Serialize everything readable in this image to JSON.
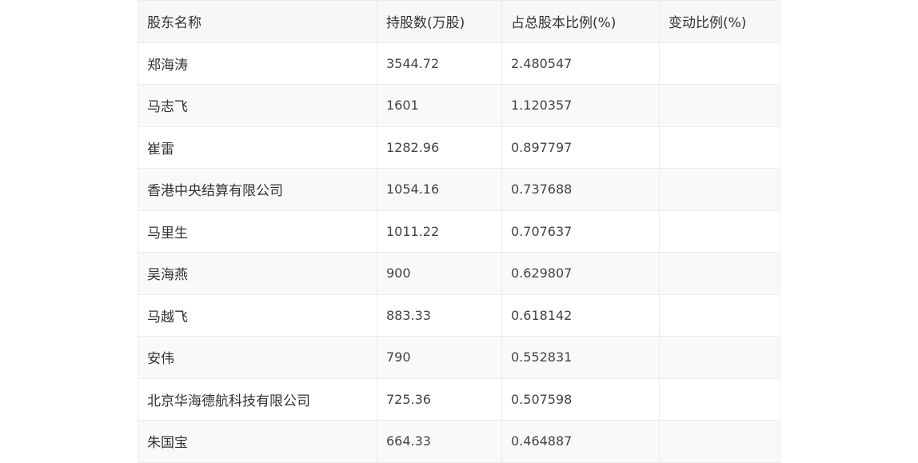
{
  "table": {
    "headers": [
      "股东名称",
      "持股数(万股)",
      "占总股本比例(%)",
      "变动比例(%)"
    ],
    "rows": [
      {
        "name": "郑海涛",
        "shares": "3544.72",
        "ratio": "2.480547",
        "change": ""
      },
      {
        "name": "马志飞",
        "shares": "1601",
        "ratio": "1.120357",
        "change": ""
      },
      {
        "name": "崔雷",
        "shares": "1282.96",
        "ratio": "0.897797",
        "change": ""
      },
      {
        "name": "香港中央结算有限公司",
        "shares": "1054.16",
        "ratio": "0.737688",
        "change": ""
      },
      {
        "name": "马里生",
        "shares": "1011.22",
        "ratio": "0.707637",
        "change": ""
      },
      {
        "name": "吴海燕",
        "shares": "900",
        "ratio": "0.629807",
        "change": ""
      },
      {
        "name": "马越飞",
        "shares": "883.33",
        "ratio": "0.618142",
        "change": ""
      },
      {
        "name": "安伟",
        "shares": "790",
        "ratio": "0.552831",
        "change": ""
      },
      {
        "name": "北京华海德航科技有限公司",
        "shares": "725.36",
        "ratio": "0.507598",
        "change": ""
      },
      {
        "name": "朱国宝",
        "shares": "664.33",
        "ratio": "0.464887",
        "change": ""
      }
    ]
  }
}
